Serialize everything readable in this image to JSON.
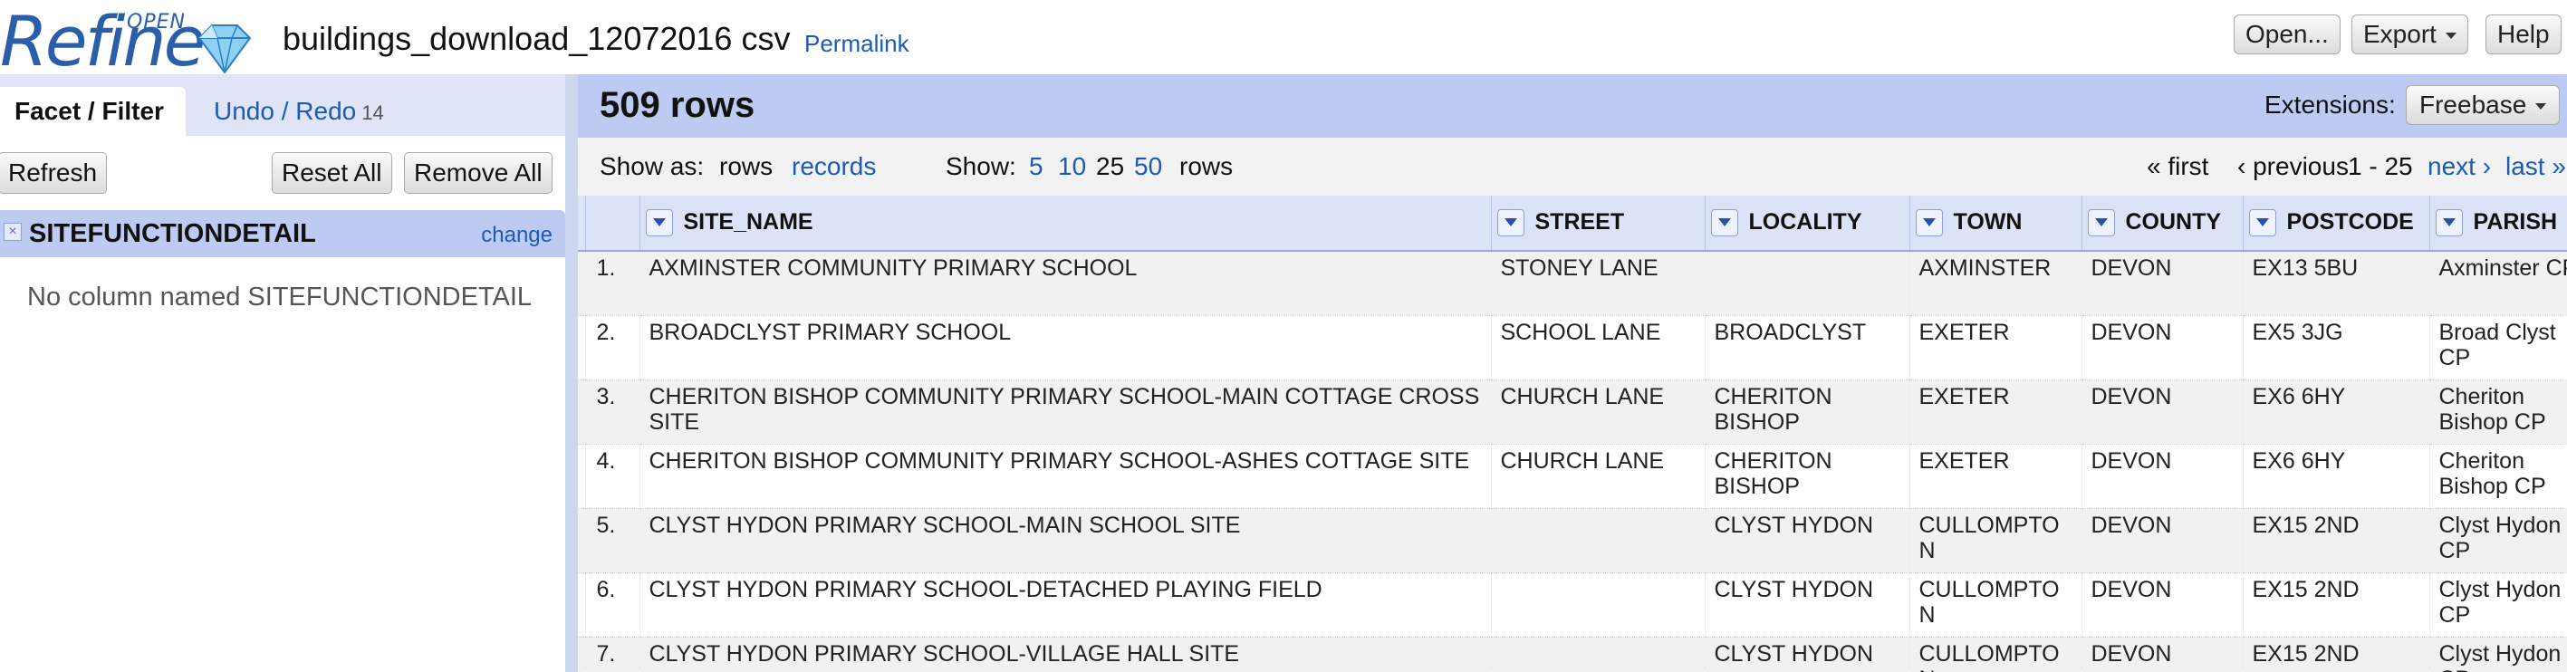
{
  "header": {
    "logo_text": "Refine",
    "logo_open": "OPEN",
    "project_name": "buildings_download_12072016 csv",
    "permalink": "Permalink",
    "open_label": "Open...",
    "export_label": "Export",
    "help_label": "Help"
  },
  "left_panel": {
    "tab_facet": "Facet / Filter",
    "tab_undo": "Undo / Redo",
    "undo_count": "14",
    "refresh": "Refresh",
    "reset_all": "Reset All",
    "remove_all": "Remove All",
    "facet": {
      "close": "×",
      "title": "SITEFUNCTIONDETAIL",
      "change": "change",
      "message": "No column named SITEFUNCTIONDETAIL"
    }
  },
  "main": {
    "rows_count": "509 rows",
    "extensions_label": "Extensions:",
    "extensions_value": "Freebase",
    "show_as_label": "Show as:",
    "show_rows": "rows",
    "show_records": "records",
    "show_label": "Show:",
    "page_sizes": [
      "5",
      "10",
      "25",
      "50"
    ],
    "rows_word": "rows",
    "first": "« first",
    "previous": "‹ previous",
    "range": "1 - 25",
    "next": "next ›",
    "last": "last »"
  },
  "table": {
    "columns": [
      "SITE_NAME",
      "STREET",
      "LOCALITY",
      "TOWN",
      "COUNTY",
      "POSTCODE",
      "PARISH"
    ],
    "rows": [
      {
        "num": "1.",
        "cells": [
          "AXMINSTER COMMUNITY PRIMARY SCHOOL",
          "STONEY LANE",
          "",
          "AXMINSTER",
          "DEVON",
          "EX13 5BU",
          "Axminster CP"
        ]
      },
      {
        "num": "2.",
        "cells": [
          "BROADCLYST PRIMARY SCHOOL",
          "SCHOOL LANE",
          "BROADCLYST",
          "EXETER",
          "DEVON",
          "EX5 3JG",
          "Broad Clyst CP"
        ]
      },
      {
        "num": "3.",
        "cells": [
          "CHERITON BISHOP COMMUNITY PRIMARY SCHOOL-MAIN COTTAGE CROSS SITE",
          "CHURCH LANE",
          "CHERITON BISHOP",
          "EXETER",
          "DEVON",
          "EX6 6HY",
          "Cheriton Bishop CP"
        ]
      },
      {
        "num": "4.",
        "cells": [
          "CHERITON BISHOP COMMUNITY PRIMARY SCHOOL-ASHES COTTAGE SITE",
          "CHURCH LANE",
          "CHERITON BISHOP",
          "EXETER",
          "DEVON",
          "EX6 6HY",
          "Cheriton Bishop CP"
        ]
      },
      {
        "num": "5.",
        "cells": [
          "CLYST HYDON PRIMARY SCHOOL-MAIN SCHOOL SITE",
          "",
          "CLYST HYDON",
          "CULLOMPTON",
          "DEVON",
          "EX15 2ND",
          "Clyst Hydon CP"
        ]
      },
      {
        "num": "6.",
        "cells": [
          "CLYST HYDON PRIMARY SCHOOL-DETACHED PLAYING FIELD",
          "",
          "CLYST HYDON",
          "CULLOMPTON",
          "DEVON",
          "EX15 2ND",
          "Clyst Hydon CP"
        ]
      },
      {
        "num": "7.",
        "cells": [
          "CLYST HYDON PRIMARY SCHOOL-VILLAGE HALL SITE",
          "",
          "CLYST HYDON",
          "CULLOMPTON",
          "DEVON",
          "EX15 2ND",
          "Clyst Hydon CP"
        ]
      }
    ]
  },
  "colors": {
    "accent_blue": "#1b5ab5",
    "panel_blue": "#bdcbf2",
    "tab_bar": "#dfe5f6"
  }
}
